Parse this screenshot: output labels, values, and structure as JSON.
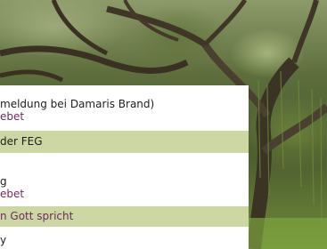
{
  "schedule": {
    "lines": [
      {
        "text": "meldung bei Damaris Brand)",
        "style": "dark"
      },
      {
        "text": "ebet",
        "style": "purple"
      },
      {
        "text": "der FEG",
        "style": "dark"
      },
      {
        "text": "g",
        "style": "dark"
      },
      {
        "text": "ebet",
        "style": "purple"
      },
      {
        "text": "n Gott spricht",
        "style": "purple"
      },
      {
        "text": "y",
        "style": "dark"
      }
    ]
  },
  "colors": {
    "highlight_band": "#ccd7a4",
    "accent_text": "#6b2d5c",
    "body_text": "#1e1e1e"
  }
}
